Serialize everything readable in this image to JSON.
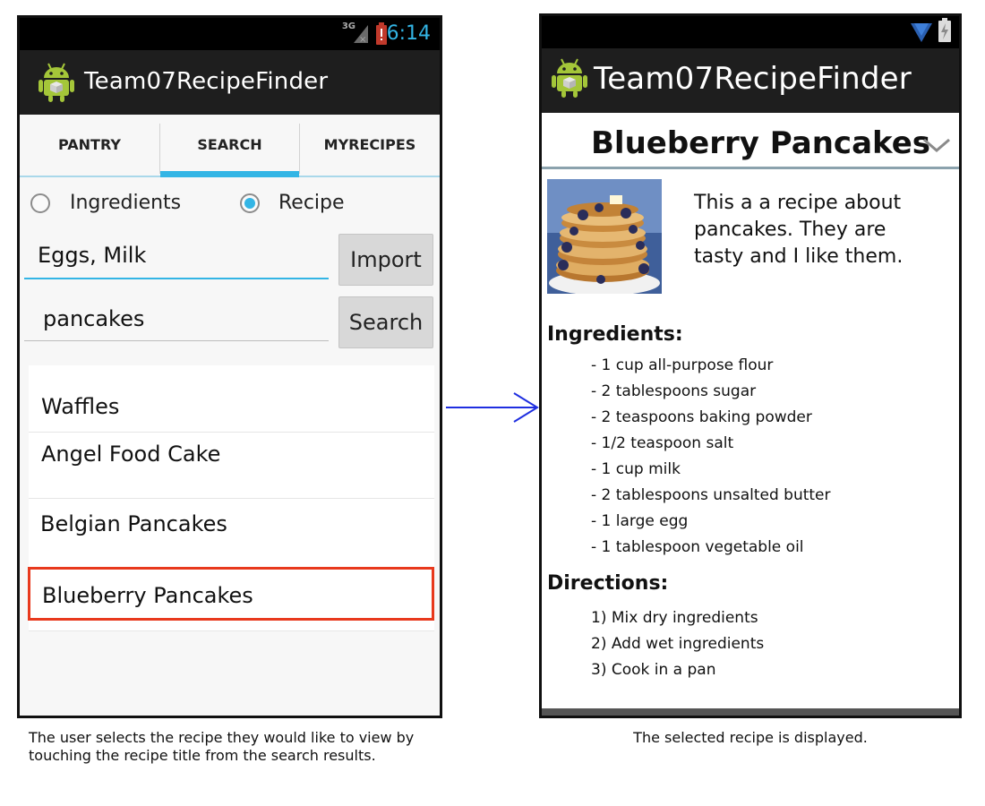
{
  "left_screen": {
    "status": {
      "network": "3G",
      "time": "6:14"
    },
    "app_title": "Team07RecipeFinder",
    "tabs": [
      {
        "label": "PANTRY",
        "selected": false
      },
      {
        "label": "SEARCH",
        "selected": true
      },
      {
        "label": "MYRECIPES",
        "selected": false
      }
    ],
    "search_mode": {
      "options": [
        {
          "label": "Ingredients",
          "selected": false
        },
        {
          "label": "Recipe",
          "selected": true
        }
      ]
    },
    "ingredients_field": {
      "value": "Eggs, Milk"
    },
    "import_button": "Import",
    "recipe_field": {
      "value": "pancakes"
    },
    "search_button": "Search",
    "results": [
      {
        "label": "Waffles"
      },
      {
        "label": "Angel Food Cake"
      },
      {
        "label": "Belgian Pancakes"
      },
      {
        "label": "Blueberry Pancakes",
        "highlighted": true
      }
    ]
  },
  "right_screen": {
    "app_title": "Team07RecipeFinder",
    "recipe_title": "Blueberry Pancakes",
    "description": "This a a recipe about pancakes. They are tasty and I like them.",
    "ingredients_heading": "Ingredients:",
    "ingredients": [
      "- 1 cup all-purpose flour",
      "- 2 tablespoons sugar",
      "- 2 teaspoons baking powder",
      "- 1/2 teaspoon salt",
      "- 1 cup milk",
      "- 2 tablespoons unsalted butter",
      "- 1 large egg",
      "- 1 tablespoon vegetable oil"
    ],
    "directions_heading": "Directions:",
    "directions": [
      "1) Mix dry ingredients",
      "2) Add wet ingredients",
      "3) Cook in a pan"
    ]
  },
  "captions": {
    "left": "The user selects the recipe they would like to view by touching the recipe title from the search results.",
    "right": "The selected recipe is displayed."
  },
  "colors": {
    "accent": "#33b5e5",
    "highlight_border": "#e8391d",
    "arrow": "#1f2fe0",
    "actionbar": "#1e1e1e"
  }
}
